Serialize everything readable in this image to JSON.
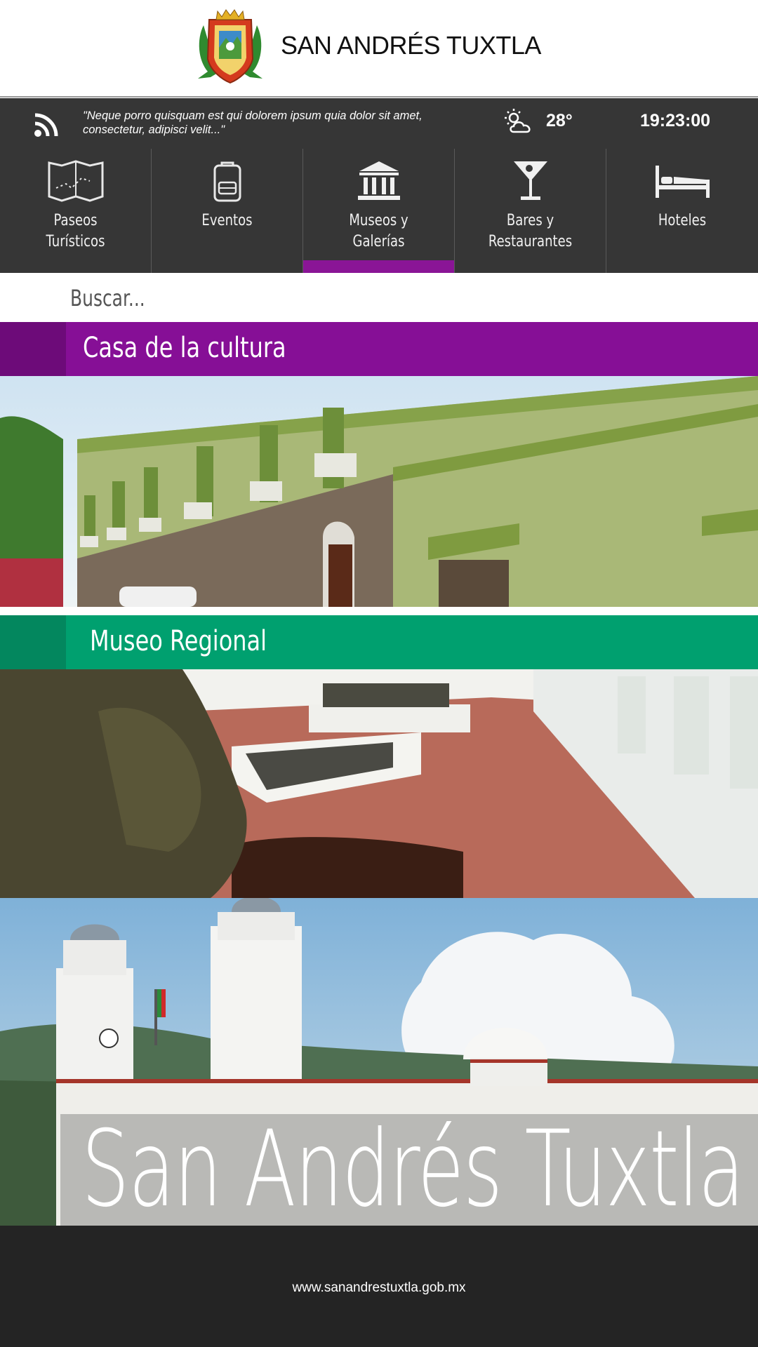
{
  "header": {
    "title": "SAN ANDRÉS TUXTLA",
    "crest_icon": "municipal-crest"
  },
  "infobar": {
    "quote": "\"Neque porro quisquam est qui dolorem ipsum quia dolor sit amet, consectetur, adipisci velit...\"",
    "temperature": "28°",
    "time": "19:23:00",
    "weather_icon": "partly-sunny-icon",
    "feed_icon": "rss-icon"
  },
  "nav": {
    "items": [
      {
        "line1": "Paseos",
        "line2": "Turísticos",
        "icon": "map-icon"
      },
      {
        "line1": "Eventos",
        "line2": "",
        "icon": "backpack-icon"
      },
      {
        "line1": "Museos y",
        "line2": "Galerías",
        "icon": "museum-icon",
        "active": true
      },
      {
        "line1": "Bares y",
        "line2": "Restaurantes",
        "icon": "cocktail-icon"
      },
      {
        "line1": "Hoteles",
        "line2": "",
        "icon": "bed-icon"
      }
    ],
    "active_color": "#8a1596"
  },
  "search": {
    "placeholder": "Buscar..."
  },
  "places": [
    {
      "name": "Casa de la cultura",
      "color": "#860f96"
    },
    {
      "name": "Museo Regional",
      "color": "#00a06f"
    }
  ],
  "hero": {
    "title": "San Andrés Tuxtla"
  },
  "footer": {
    "url": "www.sanandrestuxtla.gob.mx"
  }
}
